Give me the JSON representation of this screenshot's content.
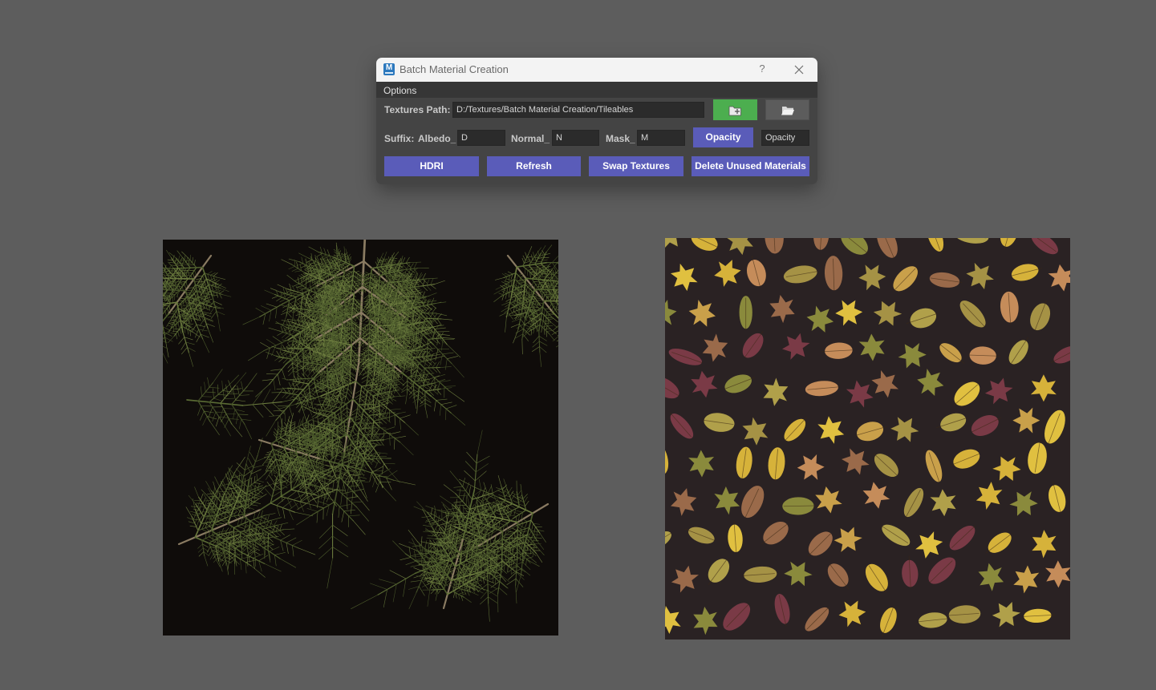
{
  "dialog": {
    "title": "Batch Material Creation",
    "help_label": "?",
    "icon": "maya-app-icon",
    "icon_letter": "M",
    "menu": {
      "options_label": "Options"
    }
  },
  "paths": {
    "label": "Textures Path:",
    "value": "D:/Textures/Batch Material Creation/Tileables",
    "add_folder_icon": "folder-add-icon",
    "browse_icon": "folder-open-icon"
  },
  "suffix": {
    "label": "Suffix:",
    "albedo_label": "Albedo_",
    "albedo_value": "D",
    "normal_label": "Normal_",
    "normal_value": "N",
    "mask_label": "Mask_",
    "mask_value": "M",
    "opacity_button": "Opacity",
    "opacity_value": "Opacity"
  },
  "actions": {
    "hdri": "HDRI",
    "refresh": "Refresh",
    "swap": "Swap Textures",
    "delete": "Delete Unused Materials"
  },
  "colors": {
    "workspace_bg": "#5d5d5d",
    "dialog_bg": "#444444",
    "accent_blue": "#5a5cb9",
    "accent_green": "#4cae4f",
    "fern_bg": "#0f0c0a",
    "leaves_bg": "#2a2223"
  },
  "textures": [
    {
      "name": "fern-branches-texture",
      "type": "fern"
    },
    {
      "name": "autumn-leaves-texture",
      "type": "leaves"
    }
  ]
}
